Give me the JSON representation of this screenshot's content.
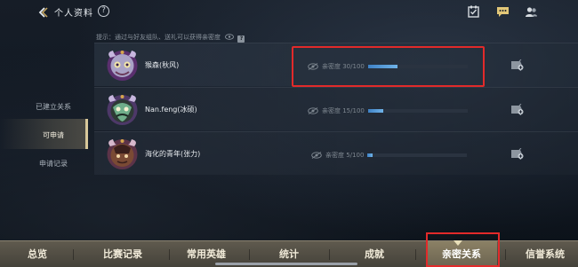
{
  "header": {
    "title": "个人资料",
    "help_label": "?"
  },
  "hint": {
    "text": "提示：通过与好友组队、送礼可以获得亲密度",
    "help_label": "?"
  },
  "sidebar": {
    "items": [
      {
        "label": "已建立关系",
        "active": false
      },
      {
        "label": "可申请",
        "active": true
      },
      {
        "label": "申请记录",
        "active": false
      }
    ]
  },
  "friends": [
    {
      "name": "猴森(秋风)",
      "intimacy_text": "亲密度 30/100",
      "intimacy_value": 30,
      "intimacy_max": 100
    },
    {
      "name": "Nan.feng(冰硕)",
      "intimacy_text": "亲密度 15/100",
      "intimacy_value": 15,
      "intimacy_max": 100
    },
    {
      "name": "海化的青年(张力)",
      "intimacy_text": "亲密度 5/100",
      "intimacy_value": 5,
      "intimacy_max": 100
    }
  ],
  "bottom_nav": {
    "items": [
      {
        "label": "总览"
      },
      {
        "label": "比赛记录"
      },
      {
        "label": "常用英雄"
      },
      {
        "label": "统计"
      },
      {
        "label": "成就"
      },
      {
        "label": "亲密关系",
        "active": true
      },
      {
        "label": "信誉系统"
      }
    ]
  },
  "colors": {
    "accent_bar": "#4a94d6",
    "highlight_box": "#e22a2a",
    "nav_bg": "#5a564a"
  },
  "icons": [
    "back-arrow-icon",
    "help-icon",
    "task-icon",
    "chat-icon",
    "friends-icon",
    "eye-icon",
    "add-friend-icon"
  ]
}
